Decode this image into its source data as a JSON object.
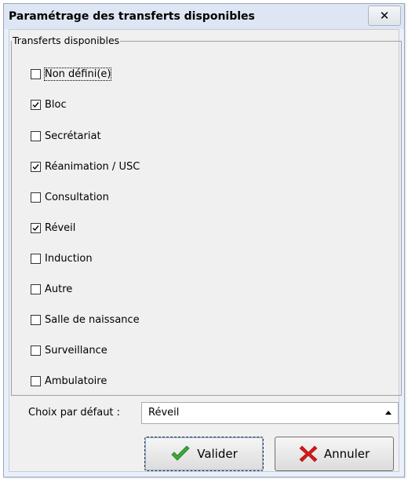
{
  "dialog": {
    "title": "Paramétrage des transferts disponibles",
    "close_glyph": "✕"
  },
  "group": {
    "legend": "Transferts disponibles",
    "items": [
      {
        "label": "Non défini(e)",
        "checked": false
      },
      {
        "label": "Bloc",
        "checked": true
      },
      {
        "label": "Secrétariat",
        "checked": false
      },
      {
        "label": "Réanimation / USC",
        "checked": true
      },
      {
        "label": "Consultation",
        "checked": false
      },
      {
        "label": "Réveil",
        "checked": true
      },
      {
        "label": "Induction",
        "checked": false
      },
      {
        "label": "Autre",
        "checked": false
      },
      {
        "label": "Salle de naissance",
        "checked": false
      },
      {
        "label": "Surveillance",
        "checked": false
      },
      {
        "label": "Ambulatoire",
        "checked": false
      }
    ]
  },
  "default_choice": {
    "label": "Choix par défaut :",
    "value": "Réveil"
  },
  "buttons": {
    "valider": "Valider",
    "annuler": "Annuler"
  },
  "colors": {
    "check_green": "#3aa83a",
    "cancel_red": "#d21a1a"
  }
}
